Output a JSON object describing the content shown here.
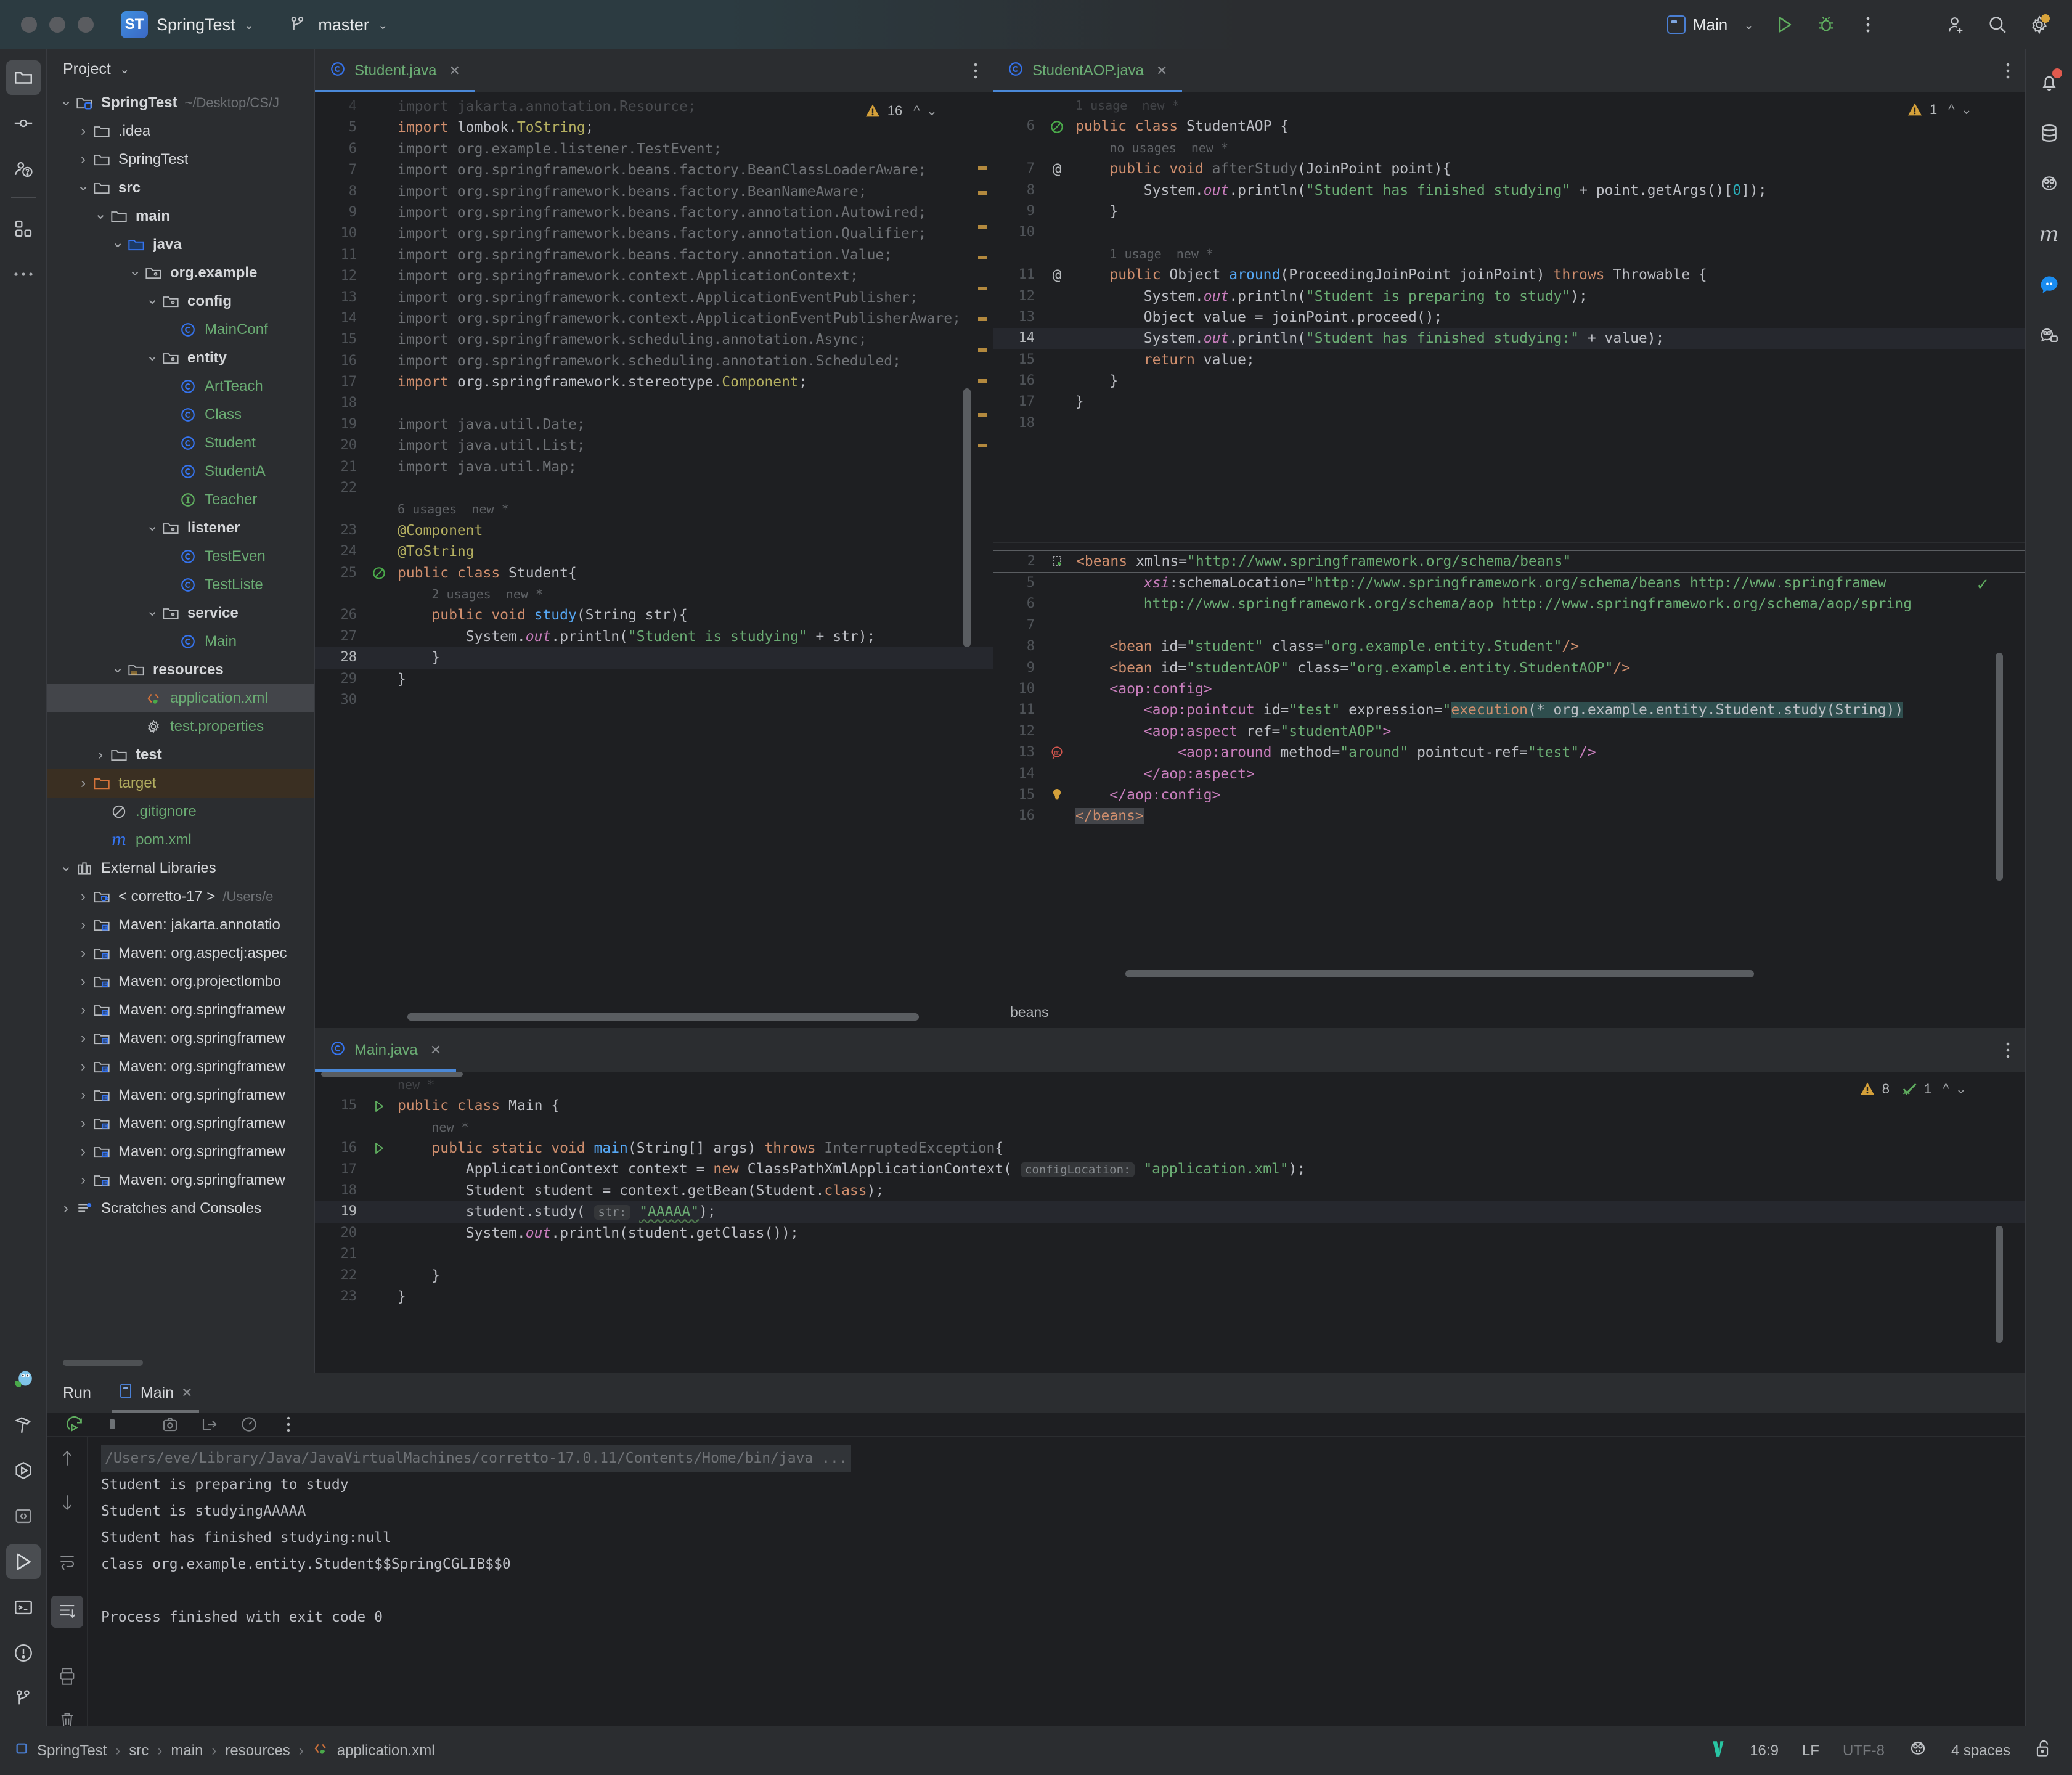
{
  "titlebar": {
    "project_initials": "ST",
    "project_name": "SpringTest",
    "branch": "master",
    "run_config": "Main"
  },
  "project_panel": {
    "title": "Project",
    "tree": [
      {
        "depth": 0,
        "arrow": "down",
        "icon": "module-folder-icon",
        "label": "SpringTest",
        "bold": true,
        "sub": "~/Desktop/CS/J",
        "name": "tree-item-springtest-root"
      },
      {
        "depth": 1,
        "arrow": "right",
        "icon": "folder-icon",
        "label": ".idea",
        "name": "tree-item-idea"
      },
      {
        "depth": 1,
        "arrow": "right",
        "icon": "folder-icon",
        "label": "SpringTest",
        "name": "tree-item-springtest"
      },
      {
        "depth": 1,
        "arrow": "down",
        "icon": "folder-icon",
        "label": "src",
        "bold": true,
        "name": "tree-item-src"
      },
      {
        "depth": 2,
        "arrow": "down",
        "icon": "folder-icon",
        "label": "main",
        "bold": true,
        "name": "tree-item-main"
      },
      {
        "depth": 3,
        "arrow": "down",
        "icon": "source-folder-icon",
        "label": "java",
        "bold": true,
        "name": "tree-item-java"
      },
      {
        "depth": 4,
        "arrow": "down",
        "icon": "package-icon",
        "label": "org.example",
        "bold": true,
        "name": "tree-item-org-example"
      },
      {
        "depth": 5,
        "arrow": "down",
        "icon": "package-icon",
        "label": "config",
        "bold": true,
        "name": "tree-item-config"
      },
      {
        "depth": 6,
        "arrow": "none",
        "icon": "java-class-icon",
        "label": "MainConf",
        "green": true,
        "name": "tree-item-mainconfig"
      },
      {
        "depth": 5,
        "arrow": "down",
        "icon": "package-icon",
        "label": "entity",
        "bold": true,
        "name": "tree-item-entity"
      },
      {
        "depth": 6,
        "arrow": "none",
        "icon": "java-class-icon",
        "label": "ArtTeach",
        "green": true,
        "name": "tree-item-artteacher"
      },
      {
        "depth": 6,
        "arrow": "none",
        "icon": "java-class-icon",
        "label": "Class",
        "green": true,
        "name": "tree-item-class"
      },
      {
        "depth": 6,
        "arrow": "none",
        "icon": "java-class-icon",
        "label": "Student",
        "green": true,
        "name": "tree-item-student"
      },
      {
        "depth": 6,
        "arrow": "none",
        "icon": "java-class-icon",
        "label": "StudentA",
        "green": true,
        "name": "tree-item-studentaop"
      },
      {
        "depth": 6,
        "arrow": "none",
        "icon": "java-interface-icon",
        "label": "Teacher",
        "green": true,
        "name": "tree-item-teacher"
      },
      {
        "depth": 5,
        "arrow": "down",
        "icon": "package-icon",
        "label": "listener",
        "bold": true,
        "name": "tree-item-listener"
      },
      {
        "depth": 6,
        "arrow": "none",
        "icon": "java-class-icon",
        "label": "TestEven",
        "green": true,
        "name": "tree-item-testevent"
      },
      {
        "depth": 6,
        "arrow": "none",
        "icon": "java-class-icon",
        "label": "TestListe",
        "green": true,
        "name": "tree-item-testlistener"
      },
      {
        "depth": 5,
        "arrow": "down",
        "icon": "package-icon",
        "label": "service",
        "bold": true,
        "name": "tree-item-service"
      },
      {
        "depth": 6,
        "arrow": "none",
        "icon": "java-class-icon",
        "label": "Main",
        "green": true,
        "name": "tree-item-main-class"
      },
      {
        "depth": 3,
        "arrow": "down",
        "icon": "resources-folder-icon",
        "label": "resources",
        "bold": true,
        "name": "tree-item-resources"
      },
      {
        "depth": 4,
        "arrow": "none",
        "icon": "spring-xml-icon",
        "label": "application.xml",
        "green": true,
        "selected": true,
        "name": "tree-item-application-xml"
      },
      {
        "depth": 4,
        "arrow": "none",
        "icon": "properties-icon",
        "label": "test.properties",
        "green": true,
        "name": "tree-item-test-properties"
      },
      {
        "depth": 2,
        "arrow": "right",
        "icon": "folder-icon",
        "label": "test",
        "bold": true,
        "name": "tree-item-test"
      },
      {
        "depth": 1,
        "arrow": "right",
        "icon": "excluded-folder-icon",
        "label": "target",
        "yellow": true,
        "highlight": true,
        "name": "tree-item-target"
      },
      {
        "depth": 2,
        "arrow": "none",
        "icon": "gitignore-icon",
        "label": ".gitignore",
        "green": true,
        "name": "tree-item-gitignore"
      },
      {
        "depth": 2,
        "arrow": "none",
        "icon": "maven-icon",
        "label": "pom.xml",
        "green": true,
        "name": "tree-item-pom-xml"
      },
      {
        "depth": 0,
        "arrow": "down",
        "icon": "external-libraries-icon",
        "label": "External Libraries",
        "name": "tree-item-external-libraries"
      },
      {
        "depth": 1,
        "arrow": "right",
        "icon": "jdk-icon",
        "label": "< corretto-17 >",
        "sub": "/Users/e",
        "name": "tree-item-corretto-17"
      },
      {
        "depth": 1,
        "arrow": "right",
        "icon": "library-icon",
        "label": "Maven: jakarta.annotatio",
        "name": "tree-item-maven-jakarta"
      },
      {
        "depth": 1,
        "arrow": "right",
        "icon": "library-icon",
        "label": "Maven: org.aspectj:aspec",
        "name": "tree-item-maven-aspectj"
      },
      {
        "depth": 1,
        "arrow": "right",
        "icon": "library-icon",
        "label": "Maven: org.projectlombo",
        "name": "tree-item-maven-lombok"
      },
      {
        "depth": 1,
        "arrow": "right",
        "icon": "library-icon",
        "label": "Maven: org.springframew",
        "name": "tree-item-maven-spring-1"
      },
      {
        "depth": 1,
        "arrow": "right",
        "icon": "library-icon",
        "label": "Maven: org.springframew",
        "name": "tree-item-maven-spring-2"
      },
      {
        "depth": 1,
        "arrow": "right",
        "icon": "library-icon",
        "label": "Maven: org.springframew",
        "name": "tree-item-maven-spring-3"
      },
      {
        "depth": 1,
        "arrow": "right",
        "icon": "library-icon",
        "label": "Maven: org.springframew",
        "name": "tree-item-maven-spring-4"
      },
      {
        "depth": 1,
        "arrow": "right",
        "icon": "library-icon",
        "label": "Maven: org.springframew",
        "name": "tree-item-maven-spring-5"
      },
      {
        "depth": 1,
        "arrow": "right",
        "icon": "library-icon",
        "label": "Maven: org.springframew",
        "name": "tree-item-maven-spring-6"
      },
      {
        "depth": 1,
        "arrow": "right",
        "icon": "library-icon",
        "label": "Maven: org.springframew",
        "name": "tree-item-maven-spring-7"
      },
      {
        "depth": 0,
        "arrow": "right",
        "icon": "scratches-icon",
        "label": "Scratches and Consoles",
        "name": "tree-item-scratches"
      }
    ]
  },
  "editor_student": {
    "tab_label": "Student.java",
    "warnings_count": "16",
    "lines": [
      {
        "n": "4",
        "html": "<span class='dim'>import jakarta.annotation.Resource;</span>",
        "clipped": true
      },
      {
        "n": "5",
        "html": "<span class='kw'>import</span> <span class='def'>lombok.</span><span class='ann'>ToString</span><span class='def'>;</span>"
      },
      {
        "n": "6",
        "html": "<span class='dim'>import org.example.listener.TestEvent;</span>"
      },
      {
        "n": "7",
        "html": "<span class='dim'>import org.springframework.beans.factory.BeanClassLoaderAware;</span>"
      },
      {
        "n": "8",
        "html": "<span class='dim'>import org.springframework.beans.factory.BeanNameAware;</span>"
      },
      {
        "n": "9",
        "html": "<span class='dim'>import org.springframework.beans.factory.annotation.Autowired;</span>"
      },
      {
        "n": "10",
        "html": "<span class='dim'>import org.springframework.beans.factory.annotation.Qualifier;</span>"
      },
      {
        "n": "11",
        "html": "<span class='dim'>import org.springframework.beans.factory.annotation.Value;</span>"
      },
      {
        "n": "12",
        "html": "<span class='dim'>import org.springframework.context.ApplicationContext;</span>"
      },
      {
        "n": "13",
        "html": "<span class='dim'>import org.springframework.context.ApplicationEventPublisher;</span>"
      },
      {
        "n": "14",
        "html": "<span class='dim'>import org.springframework.context.ApplicationEventPublisherAware;</span>"
      },
      {
        "n": "15",
        "html": "<span class='dim'>import org.springframework.scheduling.annotation.Async;</span>"
      },
      {
        "n": "16",
        "html": "<span class='dim'>import org.springframework.scheduling.annotation.Scheduled;</span>"
      },
      {
        "n": "17",
        "html": "<span class='kw'>import</span> <span class='def'>org.springframework.stereotype.</span><span class='ann'>Component</span><span class='def'>;</span>"
      },
      {
        "n": "18",
        "html": ""
      },
      {
        "n": "19",
        "html": "<span class='dim'>import java.util.Date;</span>"
      },
      {
        "n": "20",
        "html": "<span class='dim'>import java.util.List;</span>"
      },
      {
        "n": "21",
        "html": "<span class='dim'>import java.util.Map;</span>"
      },
      {
        "n": "22",
        "html": ""
      },
      {
        "n": "",
        "html": "<span class='hint'>6 usages  new *</span>"
      },
      {
        "n": "23",
        "html": "<span class='ann'>@Component</span>"
      },
      {
        "n": "24",
        "html": "<span class='ann'>@ToString</span>"
      },
      {
        "n": "25",
        "html": "<span class='kw'>public class</span> <span class='def'>Student{</span>",
        "gicon": "spring-bean-icon"
      },
      {
        "n": "",
        "html": "    <span class='hint'>2 usages  new *</span>"
      },
      {
        "n": "26",
        "html": "    <span class='kw'>public void</span> <span class='meth'>study</span><span class='def'>(String str){</span>"
      },
      {
        "n": "27",
        "html": "        <span class='def'>System.</span><span class='fld'>out</span><span class='def'>.println(</span><span class='str'>\"Student is studying\"</span><span class='def'> + str);</span>"
      },
      {
        "n": "28",
        "html": "    <span class='def'>}</span>",
        "current": true
      },
      {
        "n": "29",
        "html": "<span class='def'>}</span>"
      },
      {
        "n": "30",
        "html": ""
      }
    ]
  },
  "editor_studentaop": {
    "tab_label": "StudentAOP.java",
    "warnings_count": "1",
    "lines": [
      {
        "n": "",
        "html": "<span class='hint'>1 usage  new *</span>",
        "clipped": true
      },
      {
        "n": "6",
        "html": "<span class='kw'>public class</span> <span class='def'>StudentAOP {</span>",
        "gicon": "spring-bean-icon"
      },
      {
        "n": "",
        "html": "    <span class='hint'>no usages  new *</span>"
      },
      {
        "n": "7",
        "html": "    <span class='kw'>public void</span> <span class='dim'>afterStudy</span><span class='def'>(JoinPoint point){</span>",
        "gicon": "at-icon"
      },
      {
        "n": "8",
        "html": "        <span class='def'>System.</span><span class='fld'>out</span><span class='def'>.println(</span><span class='str'>\"Student has finished studying\"</span><span class='def'> + point.getArgs()[</span><span class='num'>0</span><span class='def'>]);</span>"
      },
      {
        "n": "9",
        "html": "    <span class='def'>}</span>"
      },
      {
        "n": "10",
        "html": ""
      },
      {
        "n": "",
        "html": "    <span class='hint'>1 usage  new *</span>"
      },
      {
        "n": "11",
        "html": "    <span class='kw'>public</span> <span class='def'>Object</span> <span class='meth'>around</span><span class='def'>(ProceedingJoinPoint joinPoint) </span><span class='kw'>throws</span><span class='def'> Throwable {</span>",
        "gicon": "at-icon"
      },
      {
        "n": "12",
        "html": "        <span class='def'>System.</span><span class='fld'>out</span><span class='def'>.println(</span><span class='str'>\"Student is preparing to study\"</span><span class='def'>);</span>"
      },
      {
        "n": "13",
        "html": "        <span class='def'>Object value = joinPoint.proceed();</span>"
      },
      {
        "n": "14",
        "html": "        <span class='def'>System.</span><span class='fld'>out</span><span class='def'>.println(</span><span class='str'>\"Student has finished studying:\"</span><span class='def'> + value);</span>",
        "current": true
      },
      {
        "n": "15",
        "html": "        <span class='kw'>return</span><span class='def'> value;</span>"
      },
      {
        "n": "16",
        "html": "    <span class='def'>}</span>"
      },
      {
        "n": "17",
        "html": "<span class='def'>}</span>"
      },
      {
        "n": "18",
        "html": ""
      }
    ]
  },
  "editor_xml": {
    "breadcrumb": "beans",
    "lines": [
      {
        "n": "2",
        "html": "<span class='xtag'>&lt;beans</span> <span class='xattr'>xmlns=</span><span class='xval'>\"http://www.springframework.org/schema/beans\"</span>",
        "gicon": "spring-file-icon",
        "boxed": true
      },
      {
        "n": "5",
        "html": "        <span class='fld'>xsi</span><span class='xattr'>:schemaLocation=</span><span class='xval'>\"http://www.springframework.org/schema/beans http://www.springframew</span>"
      },
      {
        "n": "6",
        "html": "        <span class='xval'>http://www.springframework.org/schema/aop http://www.springframework.org/schema/aop/spring</span>"
      },
      {
        "n": "7",
        "html": ""
      },
      {
        "n": "8",
        "html": "    <span class='xtag'>&lt;bean</span> <span class='xattr'>id=</span><span class='xval'>\"student\"</span> <span class='xattr'>class=</span><span class='xval'>\"org.example.entity.Student\"</span><span class='xtag'>/&gt;</span>"
      },
      {
        "n": "9",
        "html": "    <span class='xtag'>&lt;bean</span> <span class='xattr'>id=</span><span class='xval'>\"studentAOP\"</span> <span class='xattr'>class=</span><span class='xval'>\"org.example.entity.StudentAOP\"</span><span class='xtag'>/&gt;</span>"
      },
      {
        "n": "10",
        "html": "    <span class='xtagp'>&lt;aop:config&gt;</span>"
      },
      {
        "n": "11",
        "html": "        <span class='xtagp'>&lt;aop:pointcut</span> <span class='xattr'>id=</span><span class='xval'>\"test\"</span> <span class='xattr'>expression=</span><span class='xval'>\"</span><span class='sel-bg'><span class='kw'>execution</span><span class='def'>(* org.example.entity.Student.study(String))</span></span>"
      },
      {
        "n": "12",
        "html": "        <span class='xtagp'>&lt;aop:aspect</span> <span class='xattr'>ref=</span><span class='xval'>\"studentAOP\"</span><span class='xtagp'>&gt;</span>"
      },
      {
        "n": "13",
        "html": "            <span class='xtagp'>&lt;aop:around</span> <span class='xattr'>method=</span><span class='xval'>\"around\"</span> <span class='xattr'>pointcut-ref=</span><span class='xval'>\"test\"</span><span class='xtagp'>/&gt;</span>",
        "gicon": "method-nav-icon"
      },
      {
        "n": "14",
        "html": "        <span class='xtagp'>&lt;/aop:aspect&gt;</span>"
      },
      {
        "n": "15",
        "html": "    <span class='xtagp'>&lt;/aop:config&gt;</span>",
        "gicon": "bulb-icon"
      },
      {
        "n": "16",
        "html": "<span class='sel-bg2'><span class='xtag'>&lt;/beans&gt;</span></span>"
      }
    ]
  },
  "editor_main": {
    "tab_label": "Main.java",
    "warnings_count": "8",
    "checks_count": "1",
    "lines": [
      {
        "n": "",
        "html": "<span class='hint'>new *</span>",
        "clipped": true
      },
      {
        "n": "15",
        "html": "<span class='kw'>public class</span> <span class='def'>Main {</span>",
        "gicon": "run-gutter-icon"
      },
      {
        "n": "",
        "html": "    <span class='hint'>new *</span>"
      },
      {
        "n": "16",
        "html": "    <span class='kw'>public static void</span> <span class='meth'>main</span><span class='def'>(String[] args) </span><span class='kw'>throws</span> <span class='dim'>InterruptedException</span><span class='def'>{</span>",
        "gicon": "run-gutter-icon"
      },
      {
        "n": "17",
        "html": "        <span class='def'>ApplicationContext context = </span><span class='kw'>new</span><span class='def'> ClassPathXmlApplicationContext(</span> <span class='param-hint'>configLocation:</span> <span class='str'>\"application.xml\"</span><span class='def'>);</span>"
      },
      {
        "n": "18",
        "html": "        <span class='def'>Student student = context.getBean(Student.</span><span class='kw'>class</span><span class='def'>);</span>"
      },
      {
        "n": "19",
        "html": "        <span class='def'>student.study(</span> <span class='param-hint'>str:</span> <span class='str' style='text-decoration:underline wavy #4f7a4f;text-underline-offset:5px'>\"AAAAA\"</span><span class='def'>);</span>",
        "current": true
      },
      {
        "n": "20",
        "html": "        <span class='def'>System.</span><span class='fld'>out</span><span class='def'>.println(student.getClass());</span>"
      },
      {
        "n": "21",
        "html": ""
      },
      {
        "n": "22",
        "html": "    <span class='def'>}</span>"
      },
      {
        "n": "23",
        "html": "<span class='def'>}</span>"
      }
    ]
  },
  "run_panel": {
    "title": "Run",
    "tab_label": "Main",
    "output": [
      {
        "text": "/Users/eve/Library/Java/JavaVirtualMachines/corretto-17.0.11/Contents/Home/bin/java ...",
        "cmd": true
      },
      {
        "text": "Student is preparing to study"
      },
      {
        "text": "Student is studyingAAAAA"
      },
      {
        "text": "Student has finished studying:null"
      },
      {
        "text": "class org.example.entity.Student$$SpringCGLIB$$0"
      },
      {
        "text": ""
      },
      {
        "text": "Process finished with exit code 0"
      }
    ]
  },
  "statusbar": {
    "breadcrumbs": [
      "SpringTest",
      "src",
      "main",
      "resources",
      "application.xml"
    ],
    "caret": "16:9",
    "line_sep": "LF",
    "encoding": "UTF-8",
    "indent": "4 spaces"
  },
  "colors": {
    "accent_blue": "#4a88d8",
    "string_green": "#6aab73",
    "keyword_orange": "#cf8e6d",
    "warning_yellow": "#d4a03a",
    "bg_editor": "#1e1f22",
    "bg_panel": "#2b2d30"
  }
}
